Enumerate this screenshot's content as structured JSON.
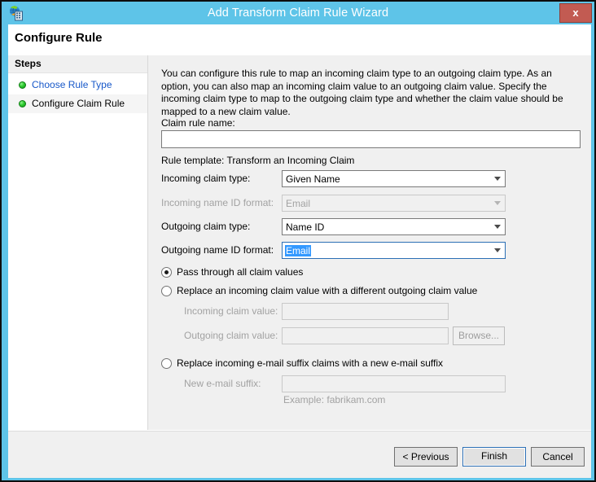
{
  "window": {
    "title": "Add Transform Claim Rule Wizard",
    "icon": "adfs-globe-icon",
    "close_label": "x",
    "frame_color": "#5ec4e8",
    "close_color": "#c25b52"
  },
  "header": {
    "title": "Configure Rule"
  },
  "sidebar": {
    "heading": "Steps",
    "items": [
      {
        "label": "Choose Rule Type",
        "is_link": true,
        "bullet": "step-complete-icon"
      },
      {
        "label": "Configure Claim Rule",
        "is_link": false,
        "bullet": "step-complete-icon"
      }
    ]
  },
  "main": {
    "intro": "You can configure this rule to map an incoming claim type to an outgoing claim type. As an option, you can also map an incoming claim value to an outgoing claim value. Specify the incoming claim type to map to the outgoing claim type and whether the claim value should be mapped to a new claim value.",
    "claim_rule_name": {
      "label": "Claim rule name:",
      "value": "",
      "placeholder": ""
    },
    "rule_template": "Rule template: Transform an Incoming Claim",
    "combos": [
      {
        "label": "Incoming claim type:",
        "value": "Given Name",
        "disabled": false,
        "focused": false,
        "selected": false
      },
      {
        "label": "Incoming name ID format:",
        "value": "Email",
        "disabled": true,
        "focused": false,
        "selected": false
      },
      {
        "label": "Outgoing claim type:",
        "value": "Name ID",
        "disabled": false,
        "focused": false,
        "selected": false
      },
      {
        "label": "Outgoing name ID format:",
        "value": "Email",
        "disabled": false,
        "focused": true,
        "selected": true
      }
    ],
    "radio_pass_through": {
      "label": "Pass through all claim values",
      "checked": true
    },
    "radio_replace_value": {
      "label": "Replace an incoming claim value with a different outgoing claim value",
      "checked": false
    },
    "incoming_claim_value": {
      "label": "Incoming claim value:",
      "value": "",
      "disabled": true
    },
    "outgoing_claim_value": {
      "label": "Outgoing claim value:",
      "value": "",
      "disabled": true
    },
    "browse_button": {
      "label": "Browse...",
      "disabled": true
    },
    "radio_replace_suffix": {
      "label": "Replace incoming e-mail suffix claims with a new e-mail suffix",
      "checked": false
    },
    "new_email_suffix": {
      "label": "New e-mail suffix:",
      "value": "",
      "disabled": true
    },
    "example_hint": "Example: fabrikam.com"
  },
  "footer": {
    "previous_label": "< Previous",
    "finish_label": "Finish",
    "cancel_label": "Cancel"
  }
}
